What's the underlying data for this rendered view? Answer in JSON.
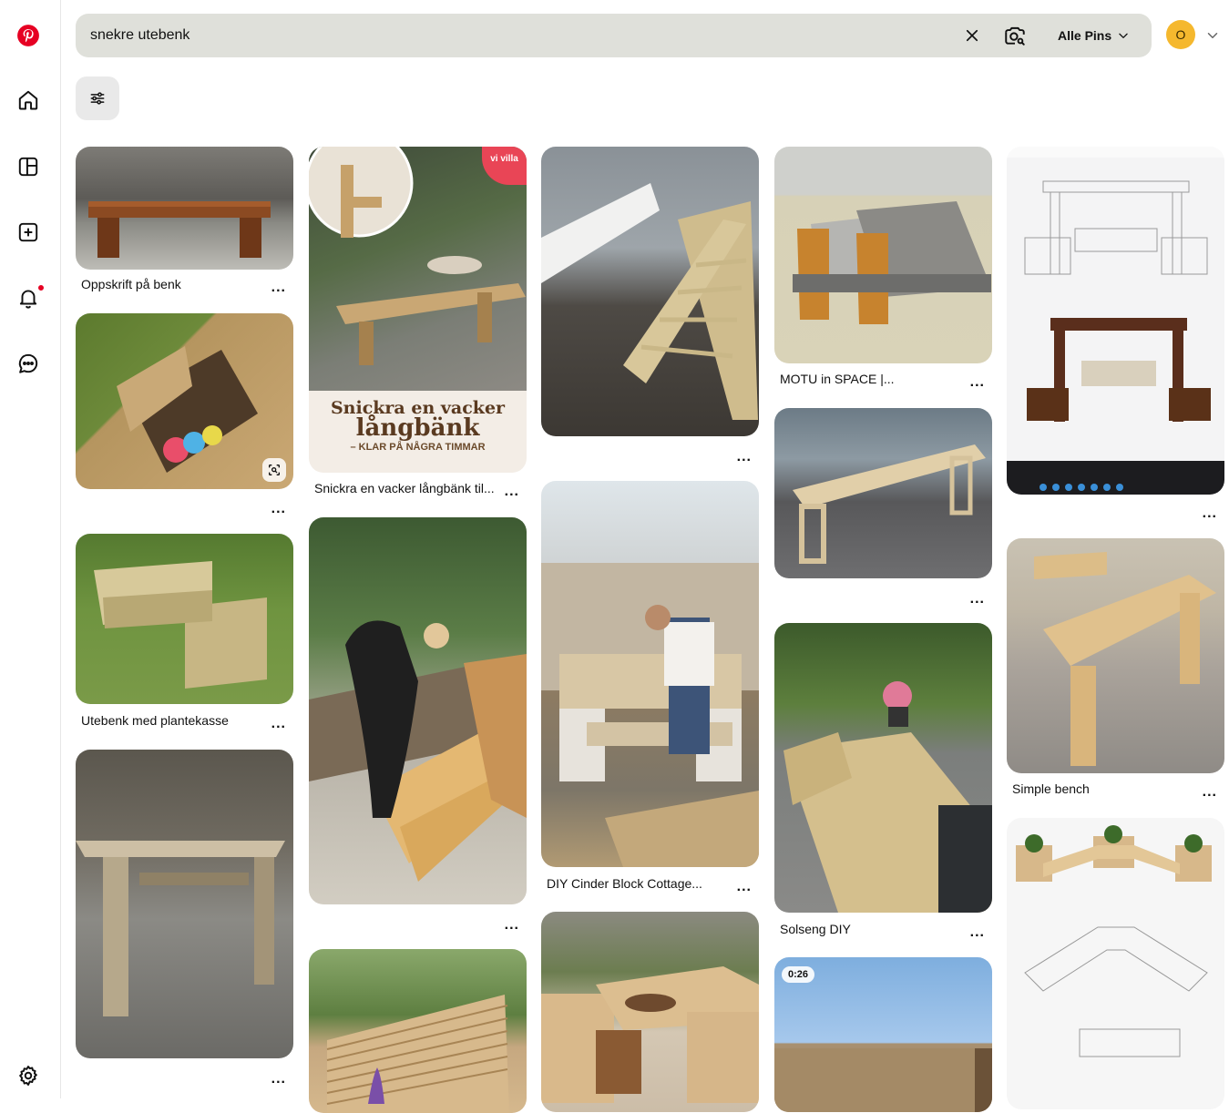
{
  "search": {
    "value": "snekre utebenk",
    "scope_label": "Alle Pins"
  },
  "account": {
    "initial": "O"
  },
  "sidebar": {
    "items": [
      {
        "name": "pinterest-logo",
        "icon": "pinterest-logo"
      },
      {
        "name": "home",
        "icon": "home-icon"
      },
      {
        "name": "boards",
        "icon": "boards-icon"
      },
      {
        "name": "create",
        "icon": "plus-square-icon"
      },
      {
        "name": "notifications",
        "icon": "bell-icon",
        "badge": true
      },
      {
        "name": "messages",
        "icon": "chat-icon"
      },
      {
        "name": "settings",
        "icon": "gear-icon"
      }
    ]
  },
  "colors": {
    "brand": "#e60023",
    "search_bg": "#dfe0da",
    "avatar_bg": "#f5b82e"
  },
  "pins": [
    {
      "id": "p1",
      "title": "Oppskrift på benk",
      "more": "..."
    },
    {
      "id": "p2",
      "title": "",
      "more": "..."
    },
    {
      "id": "p3",
      "title": "Utebenk med plantekasse",
      "more": "..."
    },
    {
      "id": "p4",
      "title": "",
      "more": "..."
    },
    {
      "id": "p5",
      "title": "Snickra en vacker långbänk til...",
      "more": "...",
      "overlay_line1": "Snickra en vacker",
      "overlay_line2": "långbänk",
      "overlay_line3": "– KLAR PÅ NÅGRA TIMMAR",
      "overlay_badge": "vi villa"
    },
    {
      "id": "p6",
      "title": "",
      "more": "..."
    },
    {
      "id": "p7",
      "title": "",
      "more": "..."
    },
    {
      "id": "p8",
      "title": "",
      "more": "..."
    },
    {
      "id": "p9",
      "title": "DIY Cinder Block Cottage...",
      "more": "..."
    },
    {
      "id": "p10",
      "title": "",
      "more": "..."
    },
    {
      "id": "p11",
      "title": "MOTU in SPACE |...",
      "more": "..."
    },
    {
      "id": "p12",
      "title": "",
      "more": "..."
    },
    {
      "id": "p13",
      "title": "Solseng DIY",
      "more": "..."
    },
    {
      "id": "p14",
      "title": "",
      "more": "...",
      "duration": "0:26"
    },
    {
      "id": "p15",
      "title": "",
      "more": "..."
    },
    {
      "id": "p16",
      "title": "Simple bench",
      "more": "..."
    },
    {
      "id": "p17",
      "title": "",
      "more": "..."
    }
  ]
}
